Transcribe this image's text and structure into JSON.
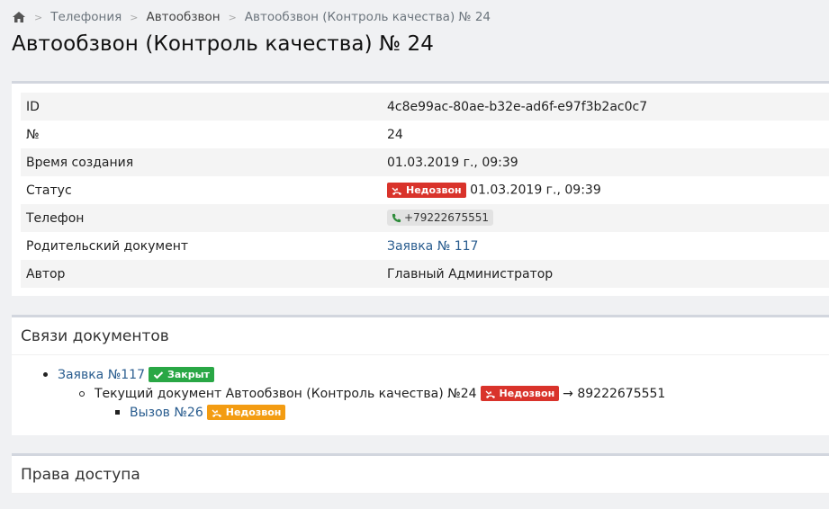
{
  "breadcrumb": {
    "items": [
      "Телефония",
      "Автообзвон",
      "Автообзвон (Контроль качества) № 24"
    ]
  },
  "page_title": "Автообзвон (Контроль качества) № 24",
  "info": {
    "id": {
      "label": "ID",
      "value": "4c8e99ac-80ae-b32e-ad6f-e97f3b2ac0c7"
    },
    "number": {
      "label": "№",
      "value": "24"
    },
    "created": {
      "label": "Время создания",
      "value": "01.03.2019 г., 09:39"
    },
    "status": {
      "label": "Статус",
      "badge": "Недозвон",
      "time": "01.03.2019 г., 09:39"
    },
    "phone": {
      "label": "Телефон",
      "value": "+79222675551"
    },
    "parent": {
      "label": "Родительский документ",
      "value": "Заявка № 117"
    },
    "author": {
      "label": "Автор",
      "value": "Главный Администратор"
    }
  },
  "links": {
    "title": "Связи документов",
    "level1": {
      "link": "Заявка №117",
      "badge": "Закрыт"
    },
    "level2": {
      "text": "Текущий документ Автообзвон (Контроль качества) №24",
      "badge": "Недозвон",
      "phone": "→ 89222675551"
    },
    "level3": {
      "link": "Вызов №26",
      "badge": "Недозвон"
    }
  },
  "access": {
    "title": "Права доступа"
  },
  "colors": {
    "badge_red": "#d9332b",
    "badge_green": "#29a745",
    "badge_orange": "#f39c12",
    "link": "#2a5d8f"
  }
}
